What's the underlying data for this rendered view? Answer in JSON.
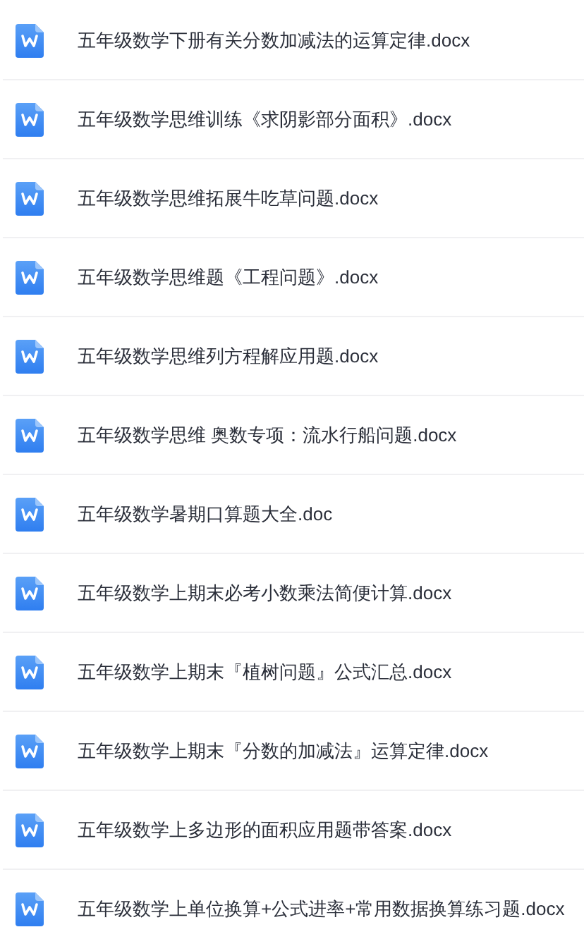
{
  "files": [
    {
      "name": "五年级数学下册有关分数加减法的运算定律.docx"
    },
    {
      "name": "五年级数学思维训练《求阴影部分面积》.docx"
    },
    {
      "name": "五年级数学思维拓展牛吃草问题.docx"
    },
    {
      "name": "五年级数学思维题《工程问题》.docx"
    },
    {
      "name": "五年级数学思维列方程解应用题.docx"
    },
    {
      "name": "五年级数学思维 奥数专项：流水行船问题.docx"
    },
    {
      "name": "五年级数学暑期口算题大全.doc"
    },
    {
      "name": "五年级数学上期末必考小数乘法简便计算.docx"
    },
    {
      "name": "五年级数学上期末『植树问题』公式汇总.docx"
    },
    {
      "name": "五年级数学上期末『分数的加减法』运算定律.docx"
    },
    {
      "name": "五年级数学上多边形的面积应用题带答案.docx"
    },
    {
      "name": "五年级数学上单位换算+公式进率+常用数据换算练习题.docx"
    }
  ]
}
